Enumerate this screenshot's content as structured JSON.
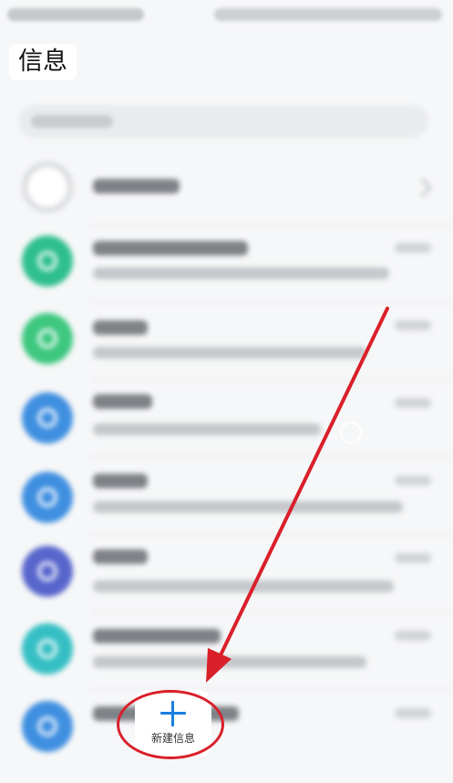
{
  "header": {
    "title": "信息"
  },
  "fab": {
    "label": "新建信息",
    "icon": "plus-icon"
  },
  "colors": {
    "accent": "#1a7ee0",
    "annotation": "#d9202a",
    "avatar_colors": [
      "#d8dadd",
      "#2fbf8f",
      "#3dc77f",
      "#3f8fe0",
      "#3f8fe0",
      "#5866cc",
      "#35bfc4",
      "#3f8fe0"
    ]
  }
}
